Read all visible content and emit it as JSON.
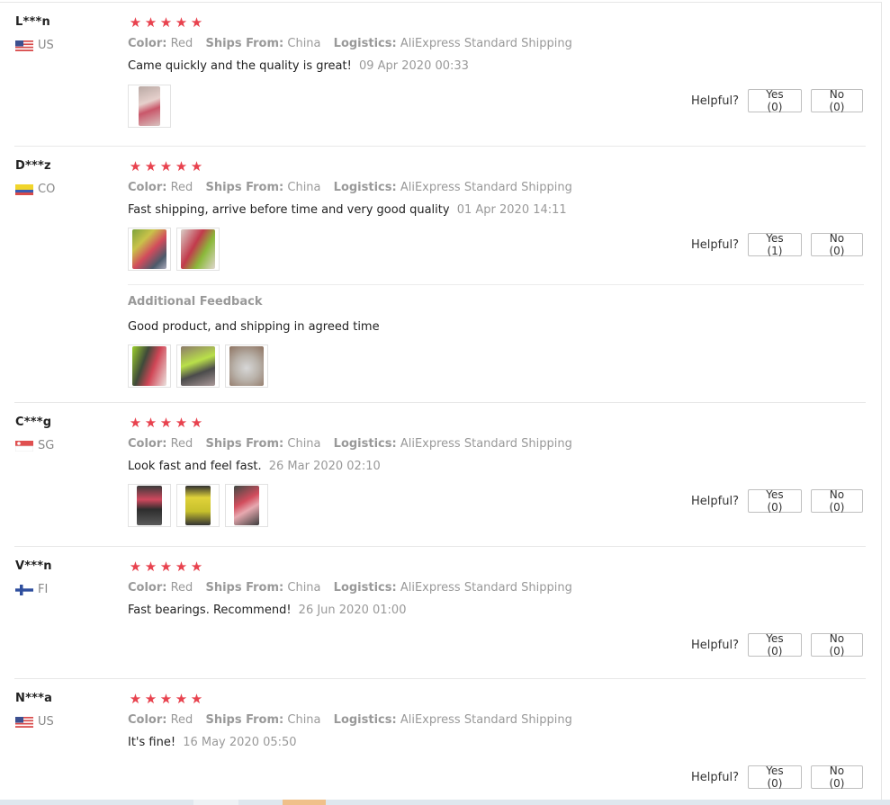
{
  "colors": {
    "star": "#e8424e",
    "muted": "#999999",
    "text": "#222222"
  },
  "labels": {
    "color": "Color:",
    "ships_from": "Ships From:",
    "logistics": "Logistics:",
    "helpful": "Helpful?",
    "additional_feedback": "Additional Feedback"
  },
  "reviews": [
    {
      "user": "L***n",
      "country": "US",
      "flag": "us-flag-icon",
      "rating": 5,
      "color": "Red",
      "ships_from": "China",
      "logistics": "AliExpress Standard Shipping",
      "text": "Came quickly and the quality is great!",
      "date": "09 Apr 2020 00:33",
      "photos": 1,
      "yes": "Yes (0)",
      "no": "No (0)"
    },
    {
      "user": "D***z",
      "country": "CO",
      "flag": "co-flag-icon",
      "rating": 5,
      "color": "Red",
      "ships_from": "China",
      "logistics": "AliExpress Standard Shipping",
      "text": "Fast shipping, arrive before time and very good quality",
      "date": "01 Apr 2020 14:11",
      "photos": 2,
      "yes": "Yes (1)",
      "no": "No (0)",
      "additional": {
        "text": "Good product, and shipping in agreed time",
        "photos": 3
      }
    },
    {
      "user": "C***g",
      "country": "SG",
      "flag": "sg-flag-icon",
      "rating": 5,
      "color": "Red",
      "ships_from": "China",
      "logistics": "AliExpress Standard Shipping",
      "text": "Look fast and feel fast.",
      "date": "26 Mar 2020 02:10",
      "photos": 3,
      "yes": "Yes (0)",
      "no": "No (0)"
    },
    {
      "user": "V***n",
      "country": "FI",
      "flag": "fi-flag-icon",
      "rating": 5,
      "color": "Red",
      "ships_from": "China",
      "logistics": "AliExpress Standard Shipping",
      "text": "Fast bearings. Recommend!",
      "date": "26 Jun 2020 01:00",
      "photos": 0,
      "yes": "Yes (0)",
      "no": "No (0)"
    },
    {
      "user": "N***a",
      "country": "US",
      "flag": "us-flag-icon",
      "rating": 5,
      "color": "Red",
      "ships_from": "China",
      "logistics": "AliExpress Standard Shipping",
      "text": "It's fine!",
      "date": "16 May 2020 05:50",
      "photos": 0,
      "yes": "Yes (0)",
      "no": "No (0)"
    }
  ]
}
